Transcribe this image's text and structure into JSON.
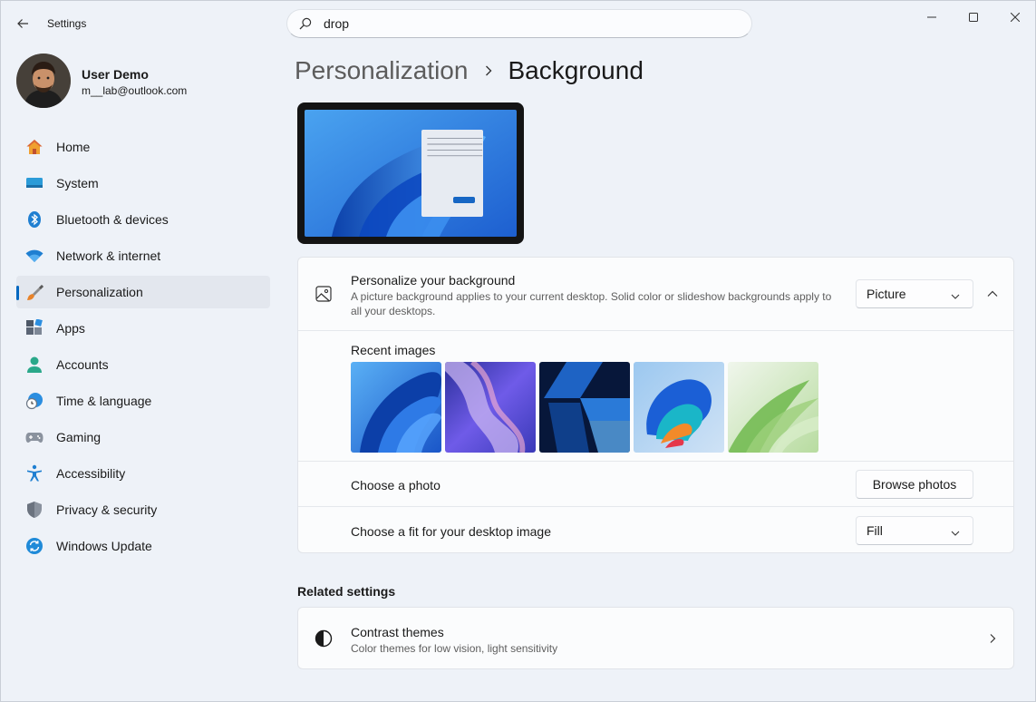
{
  "app": {
    "title": "Settings"
  },
  "search": {
    "value": "drop"
  },
  "user": {
    "name": "User Demo",
    "email": "m__lab@outlook.com"
  },
  "nav": {
    "items": [
      {
        "label": "Home",
        "icon": "home-icon"
      },
      {
        "label": "System",
        "icon": "system-icon"
      },
      {
        "label": "Bluetooth & devices",
        "icon": "bluetooth-icon"
      },
      {
        "label": "Network & internet",
        "icon": "wifi-icon"
      },
      {
        "label": "Personalization",
        "icon": "brush-icon",
        "active": true
      },
      {
        "label": "Apps",
        "icon": "apps-icon"
      },
      {
        "label": "Accounts",
        "icon": "person-icon"
      },
      {
        "label": "Time & language",
        "icon": "clock-globe-icon"
      },
      {
        "label": "Gaming",
        "icon": "gamepad-icon"
      },
      {
        "label": "Accessibility",
        "icon": "accessibility-icon"
      },
      {
        "label": "Privacy & security",
        "icon": "shield-icon"
      },
      {
        "label": "Windows Update",
        "icon": "update-icon"
      }
    ]
  },
  "header": {
    "parent": "Personalization",
    "current": "Background"
  },
  "background": {
    "title": "Personalize your background",
    "description": "A picture background applies to your current desktop. Solid color or slideshow backgrounds apply to all your desktops.",
    "type_value": "Picture",
    "recent_label": "Recent images",
    "choose_photo_label": "Choose a photo",
    "browse_label": "Browse photos",
    "fit_label": "Choose a fit for your desktop image",
    "fit_value": "Fill"
  },
  "related": {
    "title": "Related settings",
    "contrast_title": "Contrast themes",
    "contrast_desc": "Color themes for low vision, light sensitivity"
  },
  "colors": {
    "accent": "#0067c0",
    "background": "#eef2f8",
    "card": "#fbfcfd"
  }
}
